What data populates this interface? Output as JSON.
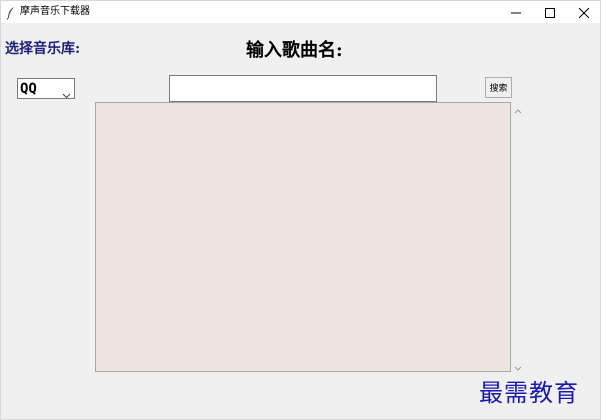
{
  "window": {
    "title": "摩声音乐下载器"
  },
  "labels": {
    "library": "选择音乐库:",
    "song_name": "输入歌曲名:"
  },
  "library_select": {
    "selected": "QQ"
  },
  "search": {
    "value": "",
    "button_label": "搜索"
  },
  "watermark": {
    "text": "最需教育"
  },
  "icons": {
    "app": "feather-icon",
    "minimize": "minimize-icon",
    "maximize": "maximize-icon",
    "close": "close-icon",
    "dropdown": "chevron-down-icon",
    "scroll_up": "chevron-up-icon",
    "scroll_down": "chevron-down-icon"
  },
  "colors": {
    "results_background": "#ede4df",
    "label_color": "#1f1f7a",
    "watermark_color": "#1a1ab0"
  }
}
